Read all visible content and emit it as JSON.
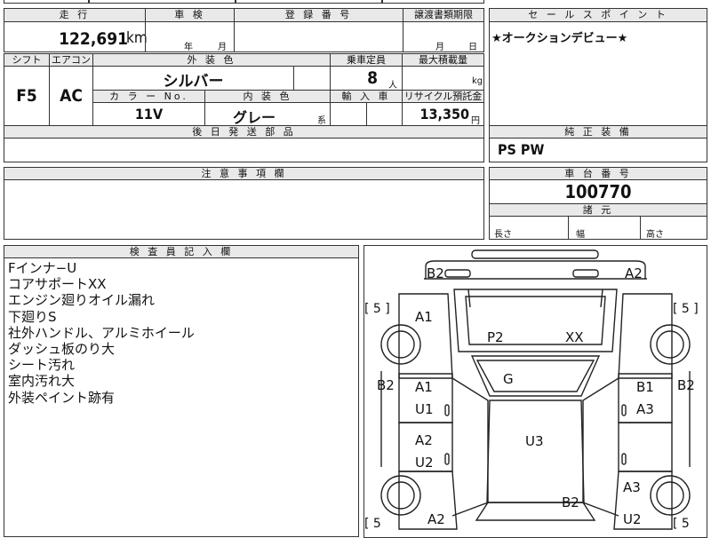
{
  "odometer": {
    "label": "走 行",
    "value": "122,691",
    "unit": "km"
  },
  "inspection": {
    "label": "車 検",
    "year_unit": "年",
    "month_unit": "月"
  },
  "registration": {
    "label": "登 録 番 号"
  },
  "transfer": {
    "label": "譲渡書類期限",
    "month_unit": "月",
    "day_unit": "日"
  },
  "sales_point": {
    "label": "セ ー ル ス ポ イ ン ト",
    "text": "★オークションデビュー★"
  },
  "shift": {
    "label": "シフト",
    "value": "F5"
  },
  "aircon": {
    "label": "エアコン",
    "value": "AC"
  },
  "exterior_color": {
    "label": "外 装 色",
    "value": "シルバー"
  },
  "capacity": {
    "label": "乗車定員",
    "value": "8",
    "unit": "人"
  },
  "max_load": {
    "label": "最大積載量",
    "unit": "kg"
  },
  "color_no": {
    "label": "カ ラ ー No.",
    "value": "11V"
  },
  "interior_color": {
    "label": "内 装 色",
    "value": "グレー",
    "suffix": "系"
  },
  "import_car": {
    "label": "輸 入 車"
  },
  "recycle": {
    "label": "リサイクル預託金",
    "value": "13,350",
    "unit": "円"
  },
  "later_parts": {
    "label": "後 日 発 送 部 品"
  },
  "standard_equipment": {
    "label": "純 正 装 備",
    "value": "PS PW"
  },
  "caution": {
    "label": "注 意 事 項 欄"
  },
  "chassis": {
    "label": "車 台 番 号",
    "value": "100770"
  },
  "dimensions": {
    "label": "諸 元",
    "length": "長さ",
    "width": "幅",
    "height": "高さ"
  },
  "inspector": {
    "label": "検 査 員 記 入 欄",
    "notes": [
      "Fインナ−U",
      "コアサポートXX",
      "エンジン廻りオイル漏れ",
      "下廻りS",
      "社外ハンドル、アルミホイール",
      "ダッシュ板のり大",
      "シート汚れ",
      "室内汚れ大",
      "外装ペイント跡有"
    ]
  },
  "diagram": {
    "front_left": "B2",
    "front_right": "A2",
    "tire_fl": "[ 5 ]",
    "tire_fr": "[ 5 ]",
    "tire_rl": "[ 5",
    "tire_rr": "[ 5",
    "fender_left": "A1",
    "hood_left": "P2",
    "hood_right": "XX",
    "windshield": "G",
    "side_left_outer": "B2",
    "side_right_outer": "B2",
    "door_lf": "A1",
    "door_lf2": "U1",
    "door_lr": "A2",
    "door_lr2": "U2",
    "door_rf": "B1",
    "door_rf2": "A3",
    "roof": "U3",
    "quarter_right": "A3",
    "rear_center": "B2",
    "rear_left": "A2",
    "rear_right": "U2"
  }
}
